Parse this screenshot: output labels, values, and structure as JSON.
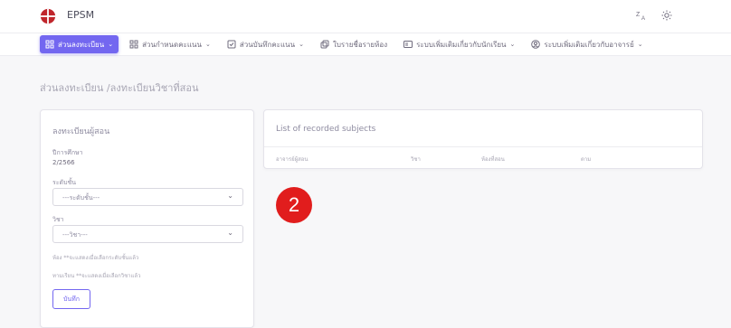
{
  "brand": {
    "name": "EPSM",
    "accent": "#7367f0",
    "logo_color": "#c0262c"
  },
  "topbar": {
    "icons": [
      "translate-icon",
      "sun-icon"
    ]
  },
  "menu": [
    {
      "label": "ส่วนลงทะเบียน",
      "icon": "grid-icon",
      "active": true
    },
    {
      "label": "ส่วนกำหนดคะแนน",
      "icon": "grid-icon",
      "active": false
    },
    {
      "label": "ส่วนบันทึกคะแนน",
      "icon": "checkbox-icon",
      "active": false
    },
    {
      "label": "ใบรายชื่อรายห้อง",
      "icon": "copy-icon",
      "active": false
    },
    {
      "label": "ระบบเพิ่มเติมเกี่ยวกับนักเรียน",
      "icon": "id-card-icon",
      "active": false
    },
    {
      "label": "ระบบเพิ่มเติมเกี่ยวกับอาจารย์",
      "icon": "user-circle-icon",
      "active": false
    }
  ],
  "breadcrumb": "ส่วนลงทะเบียน /ลงทะเบียนวิชาที่สอน",
  "form": {
    "title": "ลงทะเบียนผู้สอน",
    "term_label": "ปีการศึกษา",
    "term_value": "2/2566",
    "level_label": "ระดับชั้น",
    "level_placeholder": "---ระดับชั้น---",
    "subject_label": "วิชา",
    "subject_placeholder": "---วิชา---",
    "room_note": "ห้อง **จะแสดงเมื่อเลือกระดับชั้นแล้ว",
    "student_note": "ทามเรียน **จะแสดงเมื่อเลือกวิชาแล้ว",
    "save_label": "บันทึก"
  },
  "recorded": {
    "title": "List of recorded subjects",
    "columns": [
      "อาจารย์ผู้สอน",
      "วิชา",
      "ห้องที่สอน",
      "ตาม"
    ]
  },
  "badge": {
    "text": "2",
    "color": "#e11d1d"
  }
}
